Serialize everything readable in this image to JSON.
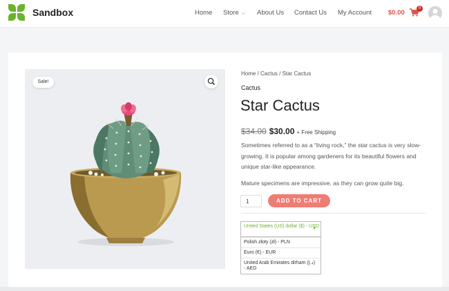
{
  "header": {
    "site_title": "Sandbox",
    "nav": [
      "Home",
      "Store",
      "About Us",
      "Contact Us",
      "My Account"
    ],
    "cart_total": "$0.00",
    "cart_count": "0",
    "icons": {
      "logo": "sandbox-logo",
      "cart": "cart-icon",
      "avatar": "user-avatar",
      "store_chevron": "chevron-down-icon"
    }
  },
  "product": {
    "sale_badge": "Sale!",
    "zoom_icon": "search-icon",
    "breadcrumb": "Home / Cactus / Star Cactus",
    "category": "Cactus",
    "title": "Star Cactus",
    "price_old": "$34.00",
    "price_new": "$30.00",
    "shipping": "+ Free Shipping",
    "description": [
      "Sometimes referred to as a “living rock,” the star cactus is very slow-growing. It is popular among gardeners for its beautiful flowers and unique star-like appearance.",
      "Mature specimens are impressive, as they can grow quite big."
    ],
    "quantity": "1",
    "add_to_cart": "ADD TO CART"
  },
  "currency": {
    "selected": "United States (US) dollar ($) - USD",
    "options": [
      "Polish złoty (zł) - PLN",
      "Euro (€) - EUR",
      "United Arab Emirates dirham (د.إ) - AED"
    ]
  },
  "colors": {
    "brand_green": "#6ab42d",
    "cart_red": "#e2524a",
    "button_salmon": "#ef7d73"
  }
}
